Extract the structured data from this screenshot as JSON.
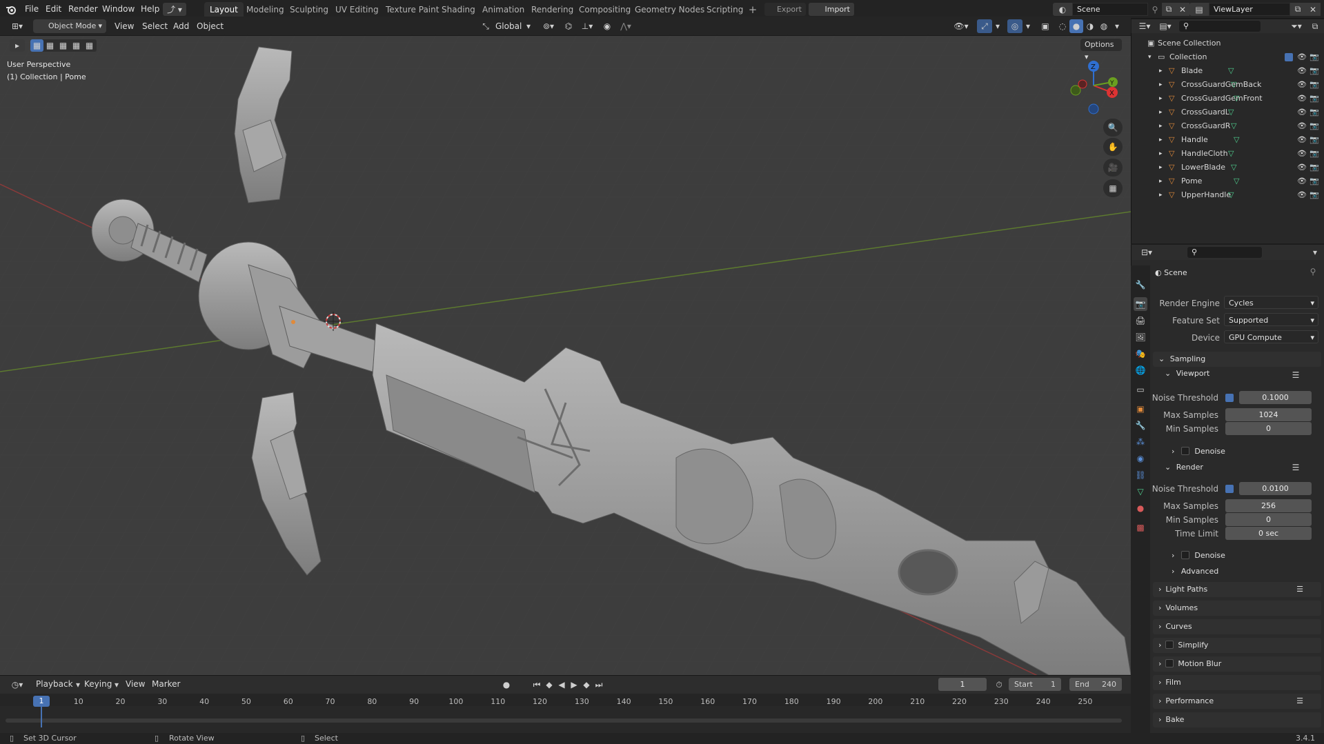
{
  "topbar": {
    "menus": [
      "File",
      "Edit",
      "Render",
      "Window",
      "Help"
    ],
    "workspaces": [
      "Layout",
      "Modeling",
      "Sculpting",
      "UV Editing",
      "Texture Paint",
      "Shading",
      "Animation",
      "Rendering",
      "Compositing",
      "Geometry Nodes",
      "Scripting"
    ],
    "active_workspace": "Layout",
    "export_label": "Export",
    "import_label": "Import",
    "scene_name": "Scene",
    "view_layer": "ViewLayer"
  },
  "viewport_header": {
    "mode": "Object Mode",
    "menus": [
      "View",
      "Select",
      "Add",
      "Object"
    ],
    "orientation": "Global",
    "options_label": "Options"
  },
  "viewport_overlay": {
    "perspective": "User Perspective",
    "context": "(1) Collection | Pome"
  },
  "outliner": {
    "root": "Scene Collection",
    "collection": "Collection",
    "objects": [
      "Blade",
      "CrossGuardGemBack",
      "CrossGuardGemFront",
      "CrossGuardL",
      "CrossGuardR",
      "Handle",
      "HandleCloth",
      "LowerBlade",
      "Pome",
      "UpperHandle"
    ]
  },
  "properties": {
    "header": "Scene",
    "render_engine_label": "Render Engine",
    "render_engine": "Cycles",
    "feature_set_label": "Feature Set",
    "feature_set": "Supported",
    "device_label": "Device",
    "device": "GPU Compute",
    "sampling_label": "Sampling",
    "viewport_label": "Viewport",
    "render_label": "Render",
    "noise_threshold_label": "Noise Threshold",
    "max_samples_label": "Max Samples",
    "min_samples_label": "Min Samples",
    "time_limit_label": "Time Limit",
    "denoise_label": "Denoise",
    "advanced_label": "Advanced",
    "viewport_noise": "0.1000",
    "viewport_max": "1024",
    "viewport_min": "0",
    "render_noise": "0.0100",
    "render_max": "256",
    "render_min": "0",
    "render_time_limit": "0 sec",
    "panels": [
      "Light Paths",
      "Volumes",
      "Curves",
      "Simplify",
      "Motion Blur",
      "Film",
      "Performance",
      "Bake"
    ]
  },
  "timeline": {
    "menus": [
      "Playback",
      "Keying",
      "View",
      "Marker"
    ],
    "current_frame": "1",
    "start_label": "Start",
    "start": "1",
    "end_label": "End",
    "end": "240",
    "ticks": [
      "1",
      "10",
      "20",
      "30",
      "40",
      "50",
      "60",
      "70",
      "80",
      "90",
      "100",
      "110",
      "120",
      "130",
      "140",
      "150",
      "160",
      "170",
      "180",
      "190",
      "200",
      "210",
      "220",
      "230",
      "240",
      "250"
    ]
  },
  "statusbar": {
    "left": "Set 3D Cursor",
    "middle": "Rotate View",
    "right": "Select",
    "version": "3.4.1"
  },
  "colors": {
    "accent": "#4772b3",
    "axis_x": "#8a3a3a",
    "axis_y": "#5d7a2f",
    "mesh": "#9b9b9b",
    "object_icon": "#e08a3a",
    "mesh_data_icon": "#4fcf8f"
  },
  "icons": {
    "eye": "eye-icon",
    "camera": "camera-icon",
    "zoom": "zoom-icon",
    "hand": "hand-icon"
  }
}
